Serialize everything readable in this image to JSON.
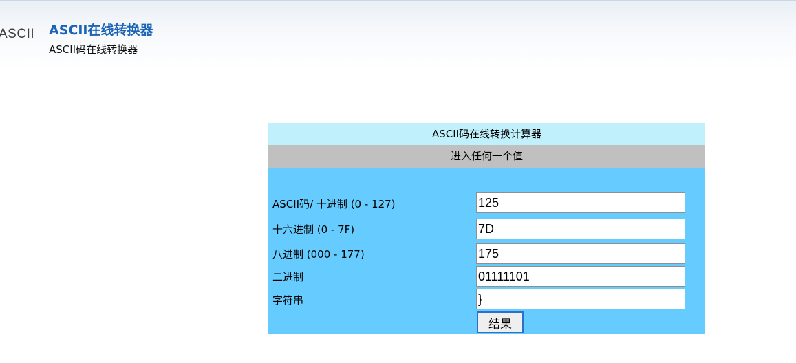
{
  "header": {
    "logo_text": "ASCII",
    "title": "ASCII在线转换器",
    "subtitle": "ASCII码在线转换器"
  },
  "converter": {
    "title": "ASCII码在线转换计算器",
    "subtitle": "进入任何一个值",
    "fields": [
      {
        "label": "ASCII码/ 十进制 (0 - 127)",
        "value": "125"
      },
      {
        "label": "十六进制 (0 - 7F)",
        "value": "7D"
      },
      {
        "label": "八进制 (000 - 177)",
        "value": "175"
      },
      {
        "label": "二进制",
        "value": "01111101"
      },
      {
        "label": "字符串",
        "value": "}"
      }
    ],
    "submit_label": "结果"
  },
  "colors": {
    "title_band": "#c0f0fc",
    "subtitle_band": "#c0c0c0",
    "body": "#66ccff",
    "header_title": "#1a63b6"
  }
}
